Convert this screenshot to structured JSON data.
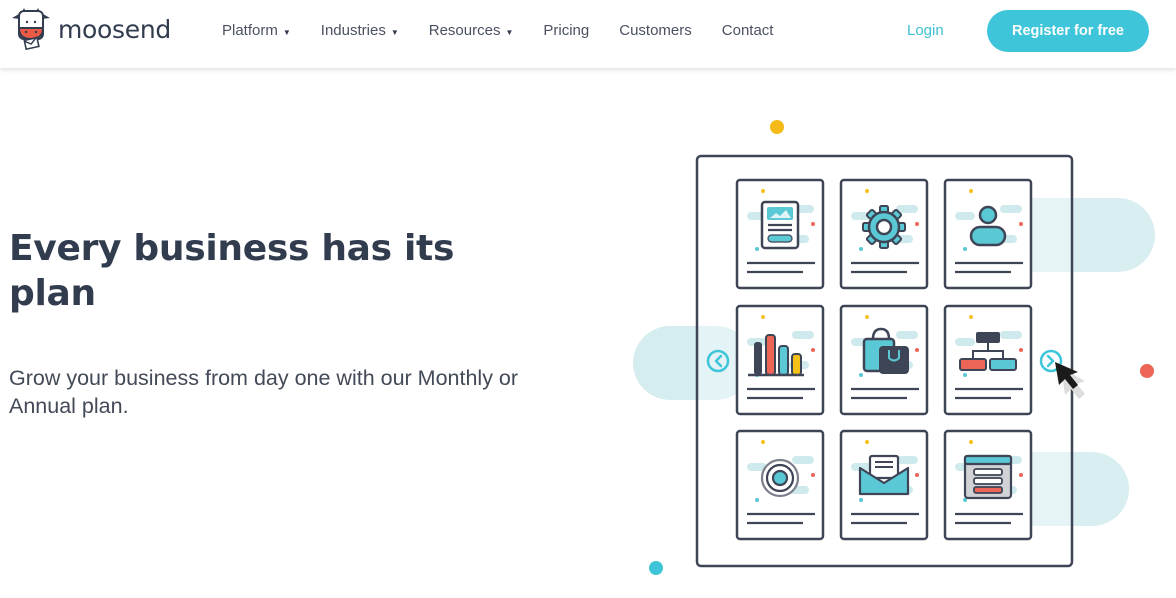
{
  "brand": {
    "name": "moosend",
    "accent": "#3ec5d9",
    "text_dark": "#323c4f"
  },
  "nav": {
    "items": [
      {
        "label": "Platform",
        "dropdown": true
      },
      {
        "label": "Industries",
        "dropdown": true
      },
      {
        "label": "Resources",
        "dropdown": true
      },
      {
        "label": "Pricing",
        "dropdown": false
      },
      {
        "label": "Customers",
        "dropdown": false
      },
      {
        "label": "Contact",
        "dropdown": false
      }
    ],
    "caret": "▼",
    "login_label": "Login",
    "register_label": "Register for free"
  },
  "hero": {
    "title": "Every business has its plan",
    "subtitle": "Grow your business from day one with our Monthly or Annual plan."
  },
  "illustration": {
    "cards": [
      {
        "icon": "landing-page-icon"
      },
      {
        "icon": "gear-icon"
      },
      {
        "icon": "user-icon"
      },
      {
        "icon": "bar-chart-icon"
      },
      {
        "icon": "shopping-bags-icon"
      },
      {
        "icon": "sitemap-icon"
      },
      {
        "icon": "target-icon"
      },
      {
        "icon": "envelope-icon"
      },
      {
        "icon": "form-icon"
      }
    ],
    "colors": {
      "teal": "#5bc8d5",
      "red": "#ec6556",
      "yellow": "#f5c018",
      "navy": "#3d4556",
      "pale": "#cfeaed"
    }
  }
}
